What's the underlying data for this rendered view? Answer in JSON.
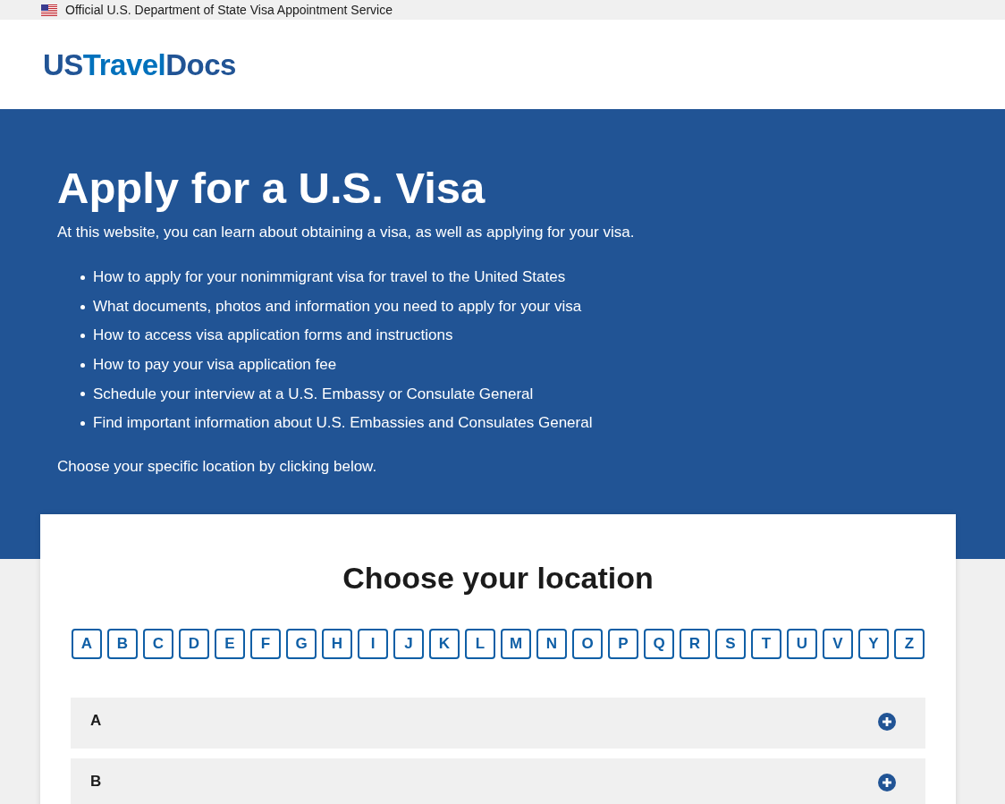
{
  "top_banner": {
    "text": "Official U.S. Department of State Visa Appointment Service"
  },
  "header": {
    "logo": [
      {
        "text": "US",
        "color": "#215495"
      },
      {
        "text": "Travel",
        "color": "#0071bc"
      },
      {
        "text": "Docs",
        "color": "#215495"
      }
    ]
  },
  "hero": {
    "title": "Apply for a U.S. Visa",
    "intro": "At this website, you can learn about obtaining a visa, as well as applying for your visa.",
    "items": [
      "How to apply for your nonimmigrant visa for travel to the United States",
      "What documents, photos and information you need to apply for your visa",
      "How to access visa application forms and instructions",
      "How to pay your visa application fee",
      "Schedule your interview at a U.S. Embassy or Consulate General",
      "Find important information about U.S. Embassies and Consulates General"
    ],
    "closing": "Choose your specific location by clicking below."
  },
  "location_card": {
    "title": "Choose your location",
    "letters": [
      "A",
      "B",
      "C",
      "D",
      "E",
      "F",
      "G",
      "H",
      "I",
      "J",
      "K",
      "L",
      "M",
      "N",
      "O",
      "P",
      "Q",
      "R",
      "S",
      "T",
      "U",
      "V",
      "Y",
      "Z"
    ],
    "sections": [
      {
        "label": "A",
        "expanded": false
      },
      {
        "label": "B",
        "expanded": false
      }
    ]
  }
}
